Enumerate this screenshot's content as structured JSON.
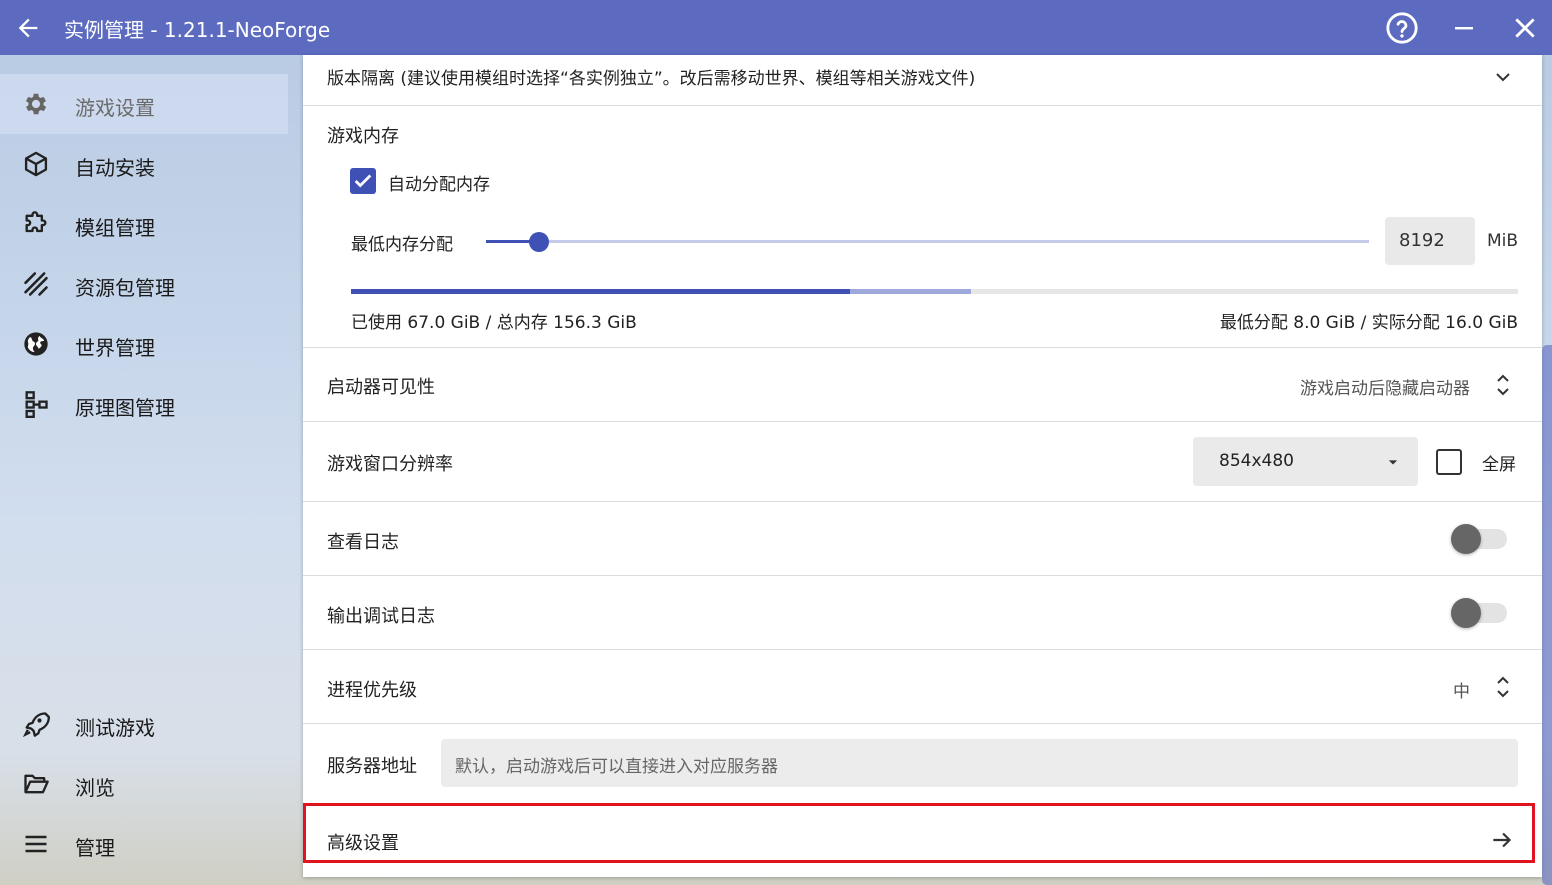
{
  "window": {
    "title": "实例管理 - 1.21.1-NeoForge"
  },
  "sidebar": {
    "items": [
      {
        "label": "游戏设置",
        "icon": "gear-icon"
      },
      {
        "label": "自动安装",
        "icon": "package-icon"
      },
      {
        "label": "模组管理",
        "icon": "puzzle-icon"
      },
      {
        "label": "资源包管理",
        "icon": "texture-icon"
      },
      {
        "label": "世界管理",
        "icon": "globe-icon"
      },
      {
        "label": "原理图管理",
        "icon": "schematic-icon"
      }
    ],
    "bottom_items": [
      {
        "label": "测试游戏",
        "icon": "rocket-icon"
      },
      {
        "label": "浏览",
        "icon": "folder-icon"
      },
      {
        "label": "管理",
        "icon": "menu-icon"
      }
    ]
  },
  "settings": {
    "version_isolation": {
      "label": "版本隔离 (建议使用模组时选择“各实例独立”。改后需移动世界、模组等相关游戏文件)"
    },
    "memory": {
      "section_label": "游戏内存",
      "auto_allocate_label": "自动分配内存",
      "auto_allocate_checked": true,
      "min_label": "最低内存分配",
      "min_value": "8192",
      "unit": "MiB",
      "slider_fraction": 0.06,
      "used_fraction": 0.428,
      "allocated_fraction": 0.531,
      "usage_text": "已使用 67.0 GiB / 总内存 156.3 GiB",
      "alloc_text": "最低分配 8.0 GiB / 实际分配 16.0 GiB"
    },
    "launcher_visibility": {
      "label": "启动器可见性",
      "value": "游戏启动后隐藏启动器"
    },
    "resolution": {
      "label": "游戏窗口分辨率",
      "value": "854x480",
      "fullscreen_label": "全屏",
      "fullscreen_checked": false
    },
    "show_logs": {
      "label": "查看日志",
      "enabled": false
    },
    "debug_logs": {
      "label": "输出调试日志",
      "enabled": false
    },
    "process_priority": {
      "label": "进程优先级",
      "value": "中"
    },
    "server_address": {
      "label": "服务器地址",
      "placeholder": "默认，启动游戏后可以直接进入对应服务器"
    },
    "advanced": {
      "label": "高级设置"
    }
  },
  "colors": {
    "accent": "#3f51b5",
    "titlebar": "#5c6bc0",
    "highlight": "#e0141e"
  }
}
